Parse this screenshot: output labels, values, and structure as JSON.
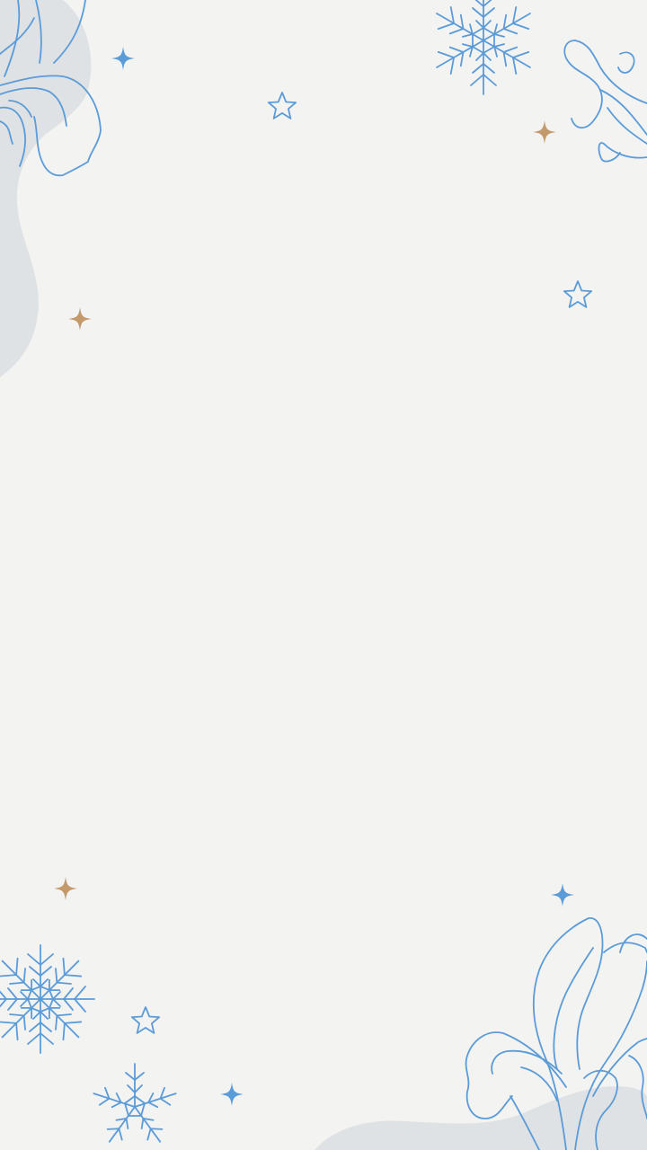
{
  "canvas": {
    "background": "#f3f3f2",
    "blob_color": "#dfe2e4",
    "line_color": "#5b9bd8",
    "sparkle_blue": "#5b9bd8",
    "sparkle_gold": "#c49a6c"
  },
  "decorations": {
    "icons": [
      "snowflake-icon",
      "star-outline-icon",
      "sparkle-icon",
      "leaf-outline-icon",
      "swirl-icon",
      "blob-shape"
    ]
  }
}
